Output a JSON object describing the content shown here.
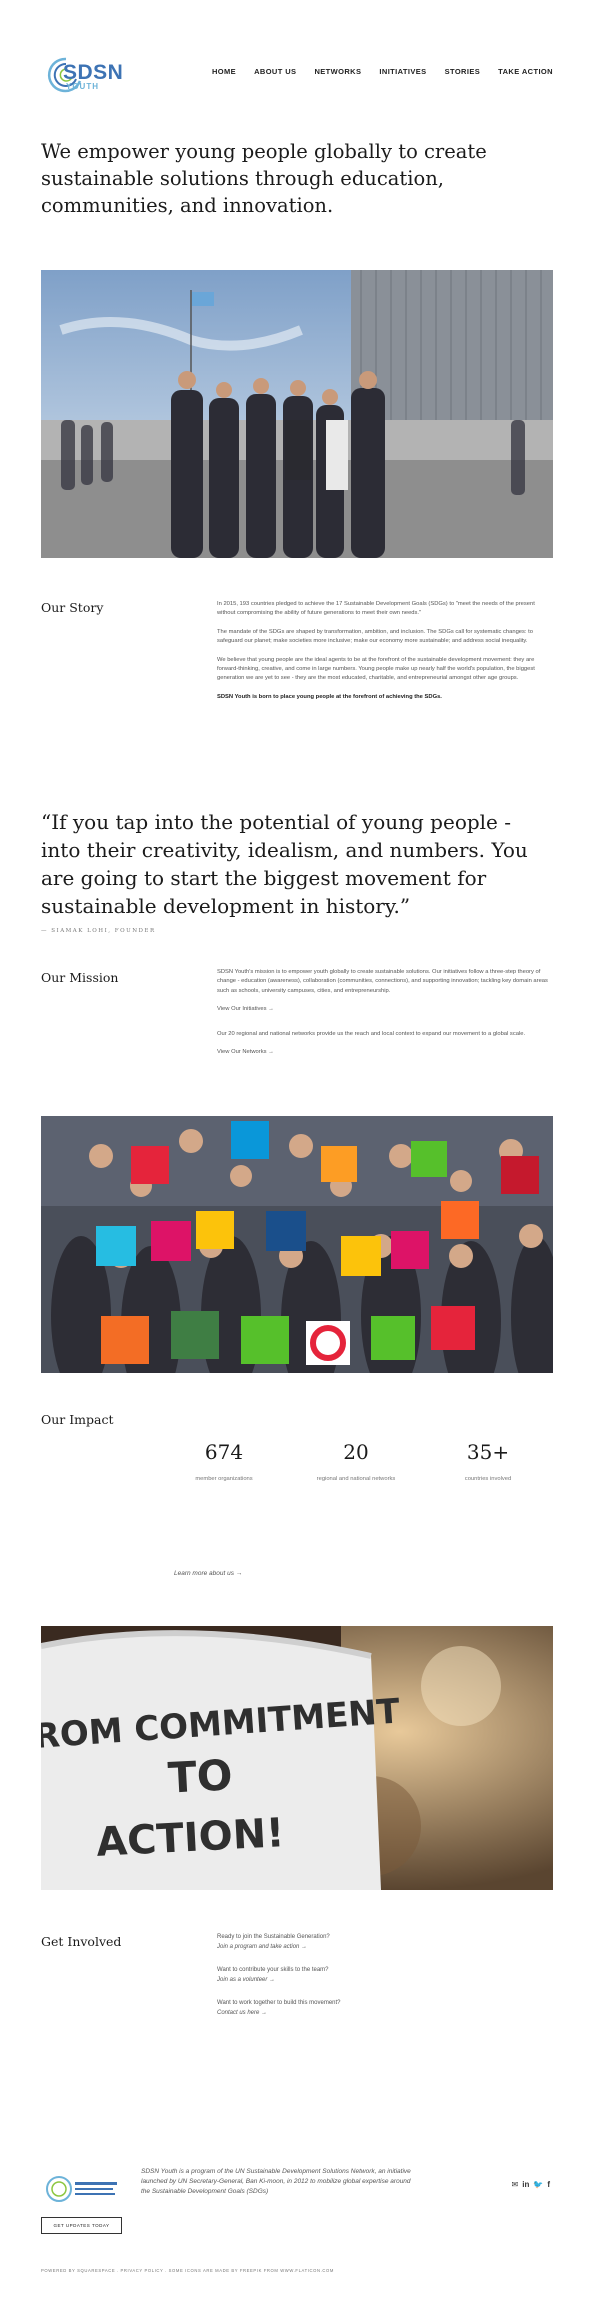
{
  "header": {
    "logo_text": "SDSN",
    "logo_sub": "YOUTH",
    "nav": [
      "HOME",
      "ABOUT US",
      "NETWORKS",
      "INITIATIVES",
      "STORIES",
      "TAKE ACTION"
    ]
  },
  "hero": {
    "headline": "We empower young people globally to create sustainable solutions through education, communities, and innovation."
  },
  "story": {
    "title": "Our Story",
    "p1": "In 2015, 193 countries pledged to achieve the 17 Sustainable Development Goals (SDGs) to \"meet the needs of the present without compromising the ability of future generations to meet their own needs.\"",
    "p2": "The mandate of the SDGs are shaped by transformation, ambition, and inclusion. The SDGs call for systematic changes: to safeguard our planet; make societies more inclusive; make our economy more sustainable; and address social inequality.",
    "p3": "We believe that young people are the ideal agents to be at the forefront of the sustainable development movement: they are forward-thinking, creative, and come in large numbers. Young people make up nearly half the world's population, the biggest generation we are yet to see - they are the most educated, charitable, and entrepreneurial amongst other age groups.",
    "p4": "SDSN Youth is born to place young people at the forefront of achieving the SDGs."
  },
  "quote": {
    "text": "“If you tap into the potential of young people - into their creativity, idealism, and numbers. You are going to start the biggest movement for sustainable development in history.”",
    "attribution": "— SIAMAK LOHI, FOUNDER"
  },
  "mission": {
    "title": "Our Mission",
    "p1": "SDSN Youth's mission is to empower youth globally to create sustainable solutions. Our initiatives follow a three-step theory of change - education (awareness), collaboration (communities, connections), and supporting innovation; tackling key domain areas such as schools, university campuses, cities, and entrepreneurship.",
    "link1": "View Our Initiatives →",
    "p2": "Our 20 regional and national networks provide us the reach and local context to expand our movement to a global scale.",
    "link2": "View Our Networks →"
  },
  "impact": {
    "title": "Our Impact",
    "stats": [
      {
        "num": "674",
        "label": "member organizations"
      },
      {
        "num": "20",
        "label": "regional and national networks"
      },
      {
        "num": "35+",
        "label": "countries involved"
      }
    ],
    "learn_more": "Learn more about us →"
  },
  "banner": {
    "shirt_text_1": "FROM COMMITMENT",
    "shirt_text_2": "TO",
    "shirt_text_3": "ACTION!"
  },
  "get_involved": {
    "title": "Get Involved",
    "items": [
      {
        "q": "Ready to join the Sustainable Generation?",
        "link": "Join a program and take action →"
      },
      {
        "q": "Want to contribute your skills to the team?",
        "link": "Join as a volunteer →"
      },
      {
        "q": "Want to work together to build this movement?",
        "link": "Contact us here →"
      }
    ]
  },
  "footer": {
    "text": "SDSN Youth is a program of the UN Sustainable Development Solutions Network, an initiative launched by UN Secretary-General, Ban Ki-moon, in 2012 to mobilize global expertise around the Sustainable Development Goals (SDGs)",
    "newsletter_button": "GET UPDATES TODAY",
    "bottom": "POWERED BY SQUARESPACE . PRIVACY POLICY . SOME ICONS ARE MADE BY FREEPIK FROM WWW.FLATICON.COM",
    "social_icons": [
      "mail-icon",
      "linkedin-icon",
      "twitter-icon",
      "facebook-icon"
    ]
  },
  "colors": {
    "brand_blue": "#3d73b4",
    "brand_light_blue": "#6db3d9"
  }
}
